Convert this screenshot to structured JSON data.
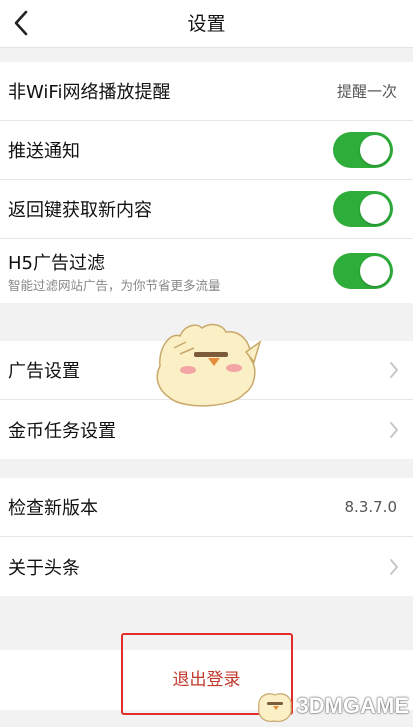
{
  "header": {
    "title": "设置"
  },
  "general": {
    "items": [
      {
        "label": "非WiFi网络播放提醒",
        "value": "提醒一次"
      },
      {
        "label": "推送通知",
        "toggle": true
      },
      {
        "label": "返回键获取新内容",
        "toggle": true
      },
      {
        "label": "H5广告过滤",
        "sublabel": "智能过滤网站广告，为你节省更多流量",
        "toggle": true
      }
    ]
  },
  "ads": {
    "items": [
      {
        "label": "广告设置"
      },
      {
        "label": "金币任务设置"
      }
    ]
  },
  "about": {
    "items": [
      {
        "label": "检查新版本",
        "value": "8.3.7.0"
      },
      {
        "label": "关于头条"
      }
    ]
  },
  "logout": {
    "label": "退出登录"
  },
  "watermark": {
    "text": "3DMGAME"
  },
  "colors": {
    "toggle_on": "#2ead3a",
    "highlight": "#e22b2b",
    "logout_text": "#c0392b"
  }
}
